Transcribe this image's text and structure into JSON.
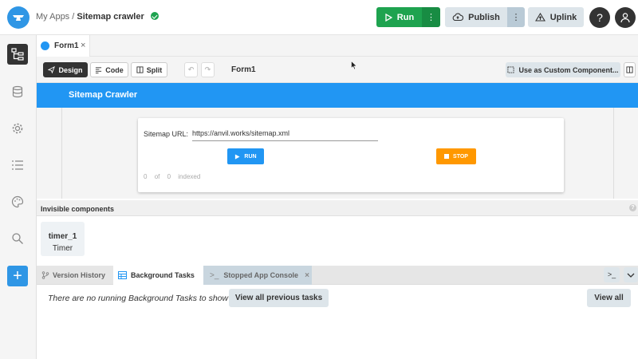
{
  "header": {
    "breadcrumb_parent": "My Apps",
    "breadcrumb_separator": "/",
    "app_name": "Sitemap crawler",
    "run_label": "Run",
    "publish_label": "Publish",
    "uplink_label": "Uplink",
    "help_label": "?"
  },
  "editor_tabs": [
    {
      "label": "Form1"
    }
  ],
  "toolbar": {
    "design_label": "Design",
    "code_label": "Code",
    "split_label": "Split",
    "form_name": "Form1",
    "custom_component_label": "Use as Custom Component..."
  },
  "form": {
    "app_title": "Sitemap Crawler",
    "url_label": "Sitemap URL:",
    "url_value": "https://anvil.works/sitemap.xml",
    "run_button": "RUN",
    "stop_button": "STOP",
    "status": {
      "count": "0",
      "of": "of",
      "total": "0",
      "indexed": "indexed"
    }
  },
  "invisible_components": {
    "header": "Invisible components",
    "items": [
      {
        "name": "timer_1",
        "type": "Timer"
      }
    ]
  },
  "bottom_tabs": [
    {
      "label": "Version History"
    },
    {
      "label": "Background Tasks"
    },
    {
      "label": "Stopped App Console"
    }
  ],
  "background_tasks": {
    "message": "There are no running Background Tasks to show",
    "view_previous_label": "View all previous tasks",
    "view_all_label": "View all"
  },
  "colors": {
    "accent": "#2196f3",
    "run_green": "#1ea34f",
    "stop_orange": "#ff9800",
    "dark": "#333333"
  }
}
